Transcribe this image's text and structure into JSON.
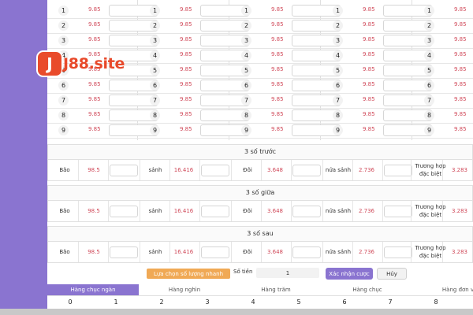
{
  "brand": {
    "logo_letter": "J",
    "logo_text": "J88.site"
  },
  "number_grid": {
    "numbers": [
      "1",
      "2",
      "3",
      "4",
      "5",
      "6",
      "7",
      "8",
      "9"
    ],
    "odds": "9.85",
    "column_count": 5
  },
  "sections": [
    {
      "title": "3 số trước",
      "items": [
        {
          "label": "Bão",
          "odds": "98.5"
        },
        {
          "label": "sảnh",
          "odds": "16.416"
        },
        {
          "label": "Đôi",
          "odds": "3.648"
        },
        {
          "label": "nửa sảnh",
          "odds": "2.736"
        },
        {
          "label": "Trương hợp đặc biệt",
          "odds": "3.283"
        }
      ]
    },
    {
      "title": "3 số giữa",
      "items": [
        {
          "label": "Bão",
          "odds": "98.5"
        },
        {
          "label": "sảnh",
          "odds": "16.416"
        },
        {
          "label": "Đôi",
          "odds": "3.648"
        },
        {
          "label": "nửa sảnh",
          "odds": "2.736"
        },
        {
          "label": "Trương hợp đặc biệt",
          "odds": "3.283"
        }
      ]
    },
    {
      "title": "3 số sau",
      "items": [
        {
          "label": "Bão",
          "odds": "98.5"
        },
        {
          "label": "sảnh",
          "odds": "16.416"
        },
        {
          "label": "Đôi",
          "odds": "3.648"
        },
        {
          "label": "nửa sảnh",
          "odds": "2.736"
        },
        {
          "label": "Trương hợp đặc biệt",
          "odds": "3.283"
        }
      ]
    }
  ],
  "controls": {
    "quick_select_label": "Lựa chọn số lượng nhanh",
    "money_label": "Số tiền",
    "money_value": "1",
    "confirm_label": "Xác nhận cược",
    "cancel_label": "Hủy"
  },
  "place_tabs": [
    {
      "label": "Hàng chục ngàn",
      "active": true
    },
    {
      "label": "Hàng nghìn",
      "active": false
    },
    {
      "label": "Hàng trăm",
      "active": false
    },
    {
      "label": "Hàng chục",
      "active": false
    },
    {
      "label": "Hàng đơn vị",
      "active": false
    }
  ],
  "digits": [
    "0",
    "1",
    "2",
    "3",
    "4",
    "5",
    "6",
    "7",
    "8"
  ],
  "colors": {
    "accent": "#8a74d0",
    "odds": "#d04a5a",
    "quick": "#f0a955",
    "brand": "#e94b2b"
  }
}
